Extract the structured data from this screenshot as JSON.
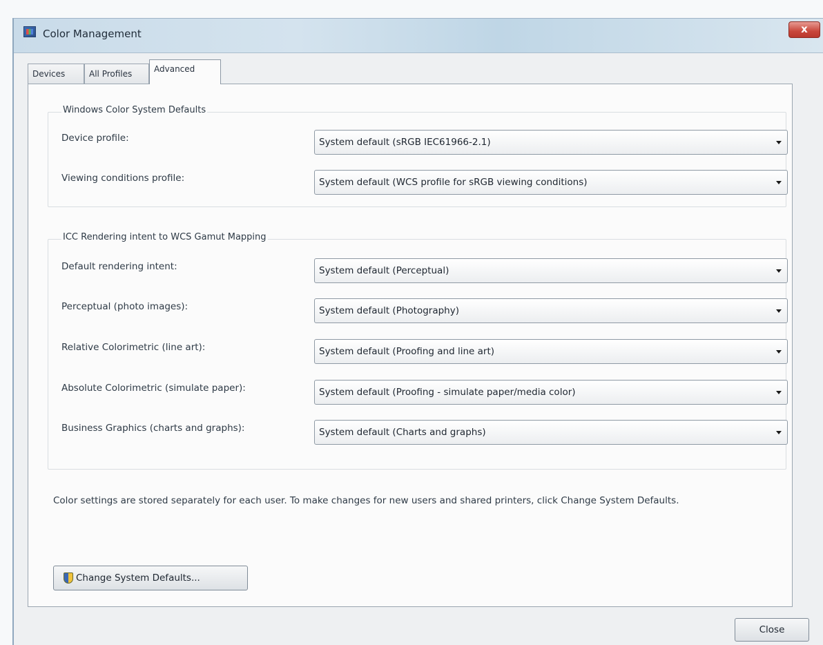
{
  "window": {
    "title": "Color Management",
    "close_glyph": "x"
  },
  "tabs": [
    {
      "label": "Devices",
      "active": false
    },
    {
      "label": "All Profiles",
      "active": false
    },
    {
      "label": "Advanced",
      "active": true
    }
  ],
  "wcs_defaults": {
    "heading": "Windows Color System Defaults",
    "rows": [
      {
        "label": "Device profile:",
        "value": "System default (sRGB IEC61966-2.1)"
      },
      {
        "label": "Viewing conditions profile:",
        "value": "System default (WCS profile for sRGB viewing conditions)"
      }
    ]
  },
  "gamut_mapping": {
    "heading": "ICC Rendering intent to WCS Gamut Mapping",
    "rows": [
      {
        "label": "Default rendering intent:",
        "value": "System default (Perceptual)"
      },
      {
        "label": "Perceptual (photo images):",
        "value": "System default (Photography)"
      },
      {
        "label": "Relative Colorimetric (line art):",
        "value": "System default (Proofing and line art)"
      },
      {
        "label": "Absolute Colorimetric (simulate paper):",
        "value": "System default (Proofing - simulate paper/media color)"
      },
      {
        "label": "Business Graphics (charts and graphs):",
        "value": "System default (Charts and graphs)"
      }
    ]
  },
  "info_text": "Color settings are stored separately for each user. To make changes for new users and shared printers, click Change System Defaults.",
  "buttons": {
    "change_defaults": "Change System Defaults...",
    "close": "Close"
  },
  "colors": {
    "titlebar": "#c9dbe9",
    "close_button": "#c9473b",
    "panel": "#fbfbfb"
  },
  "icons": {
    "app": "color-management-icon",
    "change_defaults": "uac-shield-icon"
  }
}
